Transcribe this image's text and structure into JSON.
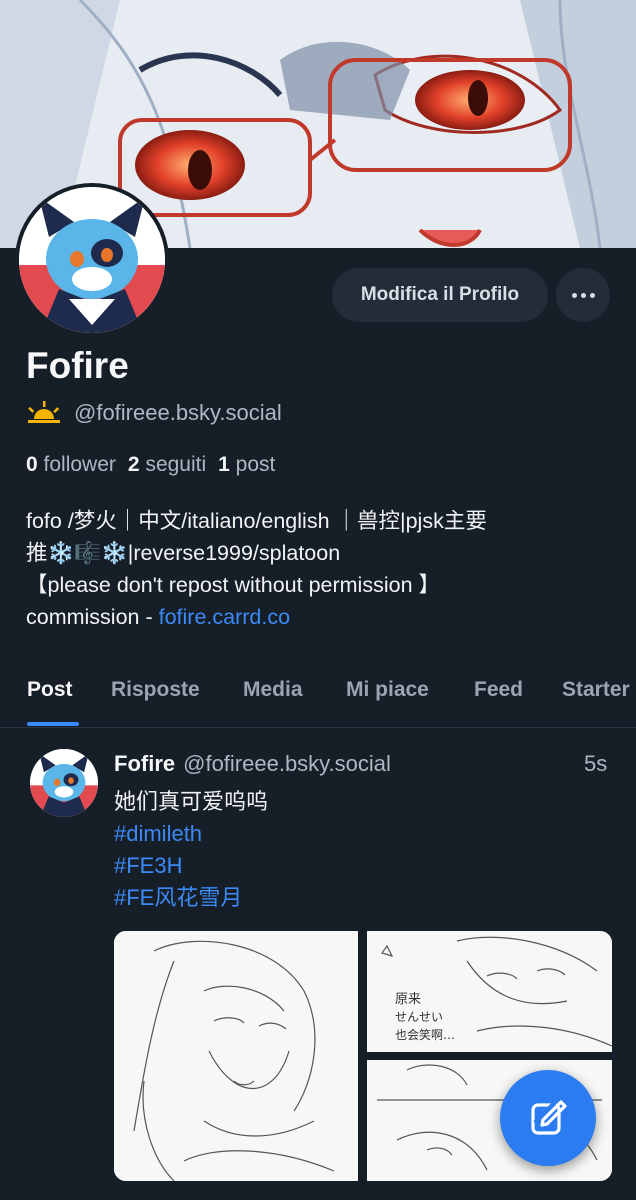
{
  "banner": {
    "alt": ""
  },
  "profile": {
    "edit_label": "Modifica il Profilo",
    "display_name": "Fofire",
    "handle": "@fofireee.bsky.social",
    "stats": {
      "followers_count": "0",
      "followers_label": "follower",
      "following_count": "2",
      "following_label": "seguiti",
      "posts_count": "1",
      "posts_label": "post"
    },
    "bio": {
      "line1": "fofo /梦火｜中文/italiano/english ｜兽控|pjsk主要",
      "line2": "推❄️🎼❄️|reverse1999/splatoon",
      "line3": "【please don't repost without permission 】",
      "line4_prefix": "commission - ",
      "line4_link": "fofire.carrd.co"
    }
  },
  "tabs": [
    "Post",
    "Risposte",
    "Media",
    "Mi piace",
    "Feed",
    "Starter"
  ],
  "post": {
    "author": "Fofire",
    "handle": "@fofireee.bsky.social",
    "time": "5s",
    "text": "她们真可爱呜呜",
    "tags": [
      "#dimileth",
      "#FE3H",
      "#FE风花雪月"
    ],
    "sketch_text": "原来\nせんせい\n也会笑啊…"
  },
  "colors": {
    "background": "#161e27",
    "accent": "#3b8af7",
    "fab": "#2b7cf0"
  }
}
